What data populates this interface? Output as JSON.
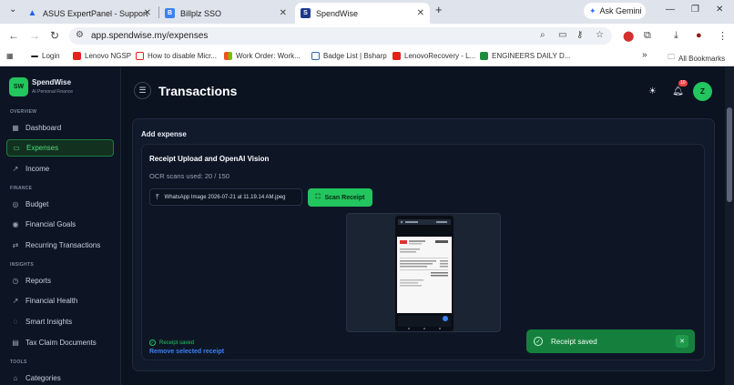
{
  "browser": {
    "tabs": [
      {
        "title": "ASUS ExpertPanel - Support"
      },
      {
        "title": "Billplz SSO",
        "icon_text": "B"
      },
      {
        "title": "SpendWise",
        "icon_text": "S"
      }
    ],
    "ask_gemini": "Ask Gemini",
    "url": "app.spendwise.my/expenses",
    "bookmarks": [
      {
        "label": "Login",
        "color": "#222222"
      },
      {
        "label": "Lenovo NGSP",
        "color": "#e2231a"
      },
      {
        "label": "How to disable Micr...",
        "color": "#e2231a"
      },
      {
        "label": "Work Order: Work...",
        "color": "#f25022"
      },
      {
        "label": "Badge List | Bsharp",
        "color": "#2b6cb0"
      },
      {
        "label": "LenovoRecovery - L...",
        "color": "#e2231a"
      },
      {
        "label": "ENGINEERS DAILY D...",
        "color": "#1e8e3e"
      }
    ],
    "all_bookmarks": "All Bookmarks"
  },
  "app": {
    "brand": {
      "logo": "SW",
      "name": "SpendWise",
      "tagline": "AI Personal Finance"
    },
    "sections": {
      "overview": "OVERVIEW",
      "finance": "FINANCE",
      "insights": "INSIGHTS",
      "tools": "TOOLS"
    },
    "nav": {
      "dashboard": "Dashboard",
      "expenses": "Expenses",
      "income": "Income",
      "budget": "Budget",
      "financial_goals": "Financial Goals",
      "recurring": "Recurring Transactions",
      "reports": "Reports",
      "financial_health": "Financial Health",
      "smart_insights": "Smart Insights",
      "tax_claim": "Tax Claim Documents",
      "categories": "Categories"
    },
    "header": {
      "title": "Transactions",
      "notif_count": "10",
      "avatar": "Z"
    },
    "add_expense": {
      "title": "Add expense",
      "receipt_title": "Receipt Upload and OpenAI Vision",
      "ocr_usage": "OCR scans used: 20 / 150",
      "file_name": "WhatsApp Image 2026-07-21 at 11.19.14 AM.jpeg",
      "scan_button": "Scan Receipt",
      "status": "Receipt saved",
      "remove_link": "Remove selected receipt"
    },
    "toast": {
      "message": "Receipt saved"
    }
  }
}
